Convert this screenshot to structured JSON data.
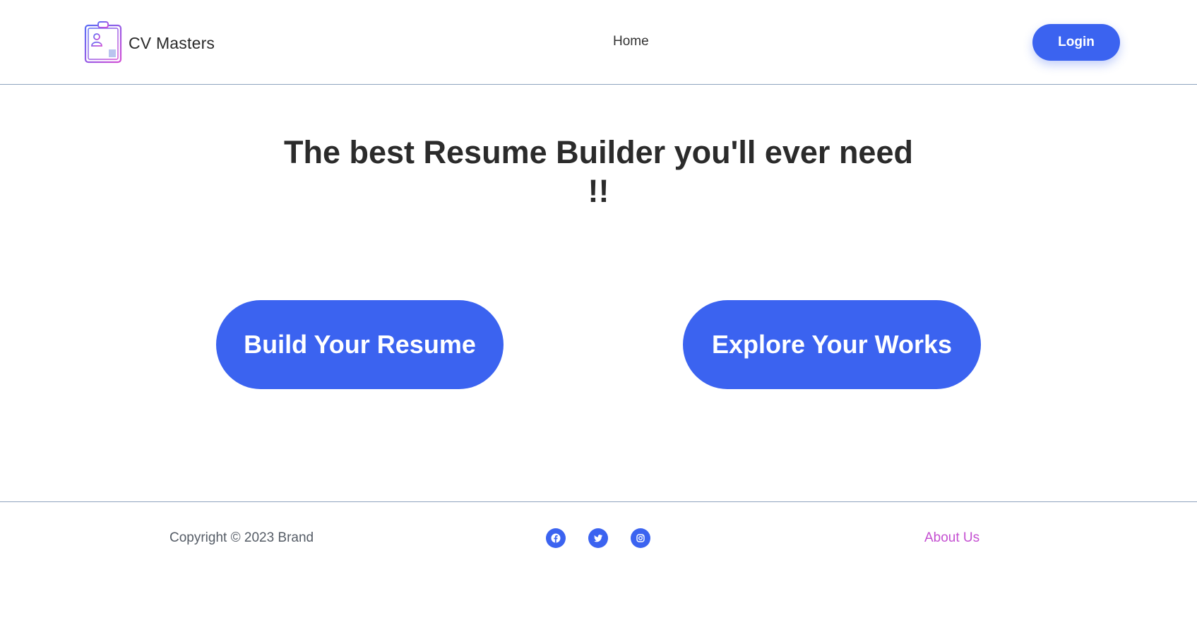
{
  "header": {
    "brand_name": "CV Masters",
    "logo_icon": "resume-clipboard-icon",
    "nav_home": "Home",
    "login_label": "Login"
  },
  "hero": {
    "title": "The best Resume Builder you'll ever need !!",
    "build_button": "Build Your Resume",
    "explore_button": "Explore Your Works"
  },
  "footer": {
    "copyright": "Copyright © 2023 Brand",
    "social_icons": [
      "facebook-icon",
      "twitter-icon",
      "instagram-icon"
    ],
    "about_link": "About Us"
  },
  "colors": {
    "accent_blue": "#3b63f0",
    "about_link_purple": "#c44fd1",
    "divider": "#8fa3bf",
    "heading_text": "#2b2b2b"
  }
}
